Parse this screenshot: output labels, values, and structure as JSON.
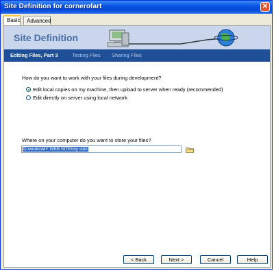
{
  "window": {
    "title": "Site Definition for cornerofart"
  },
  "tabs": {
    "basic": "Basic",
    "advanced": "Advanced"
  },
  "banner": {
    "title": "Site Definition"
  },
  "steps": {
    "current": "Editing Files, Part 3",
    "testing": "Testing Files",
    "sharing": "Sharing Files"
  },
  "question1": "How do you want to work with your files during development?",
  "options": {
    "local": {
      "label": "Edit local copies on my machine, then upload to server when ready (recommended)",
      "selected": true
    },
    "direct": {
      "label": "Edit directly on server using local network",
      "selected": false
    }
  },
  "question2": "Where on your computer do you want to store your files?",
  "path_value": "D:\\works\\MY WEB SITE\\my site\\",
  "buttons": {
    "back": "< Back",
    "next": "Next >",
    "cancel": "Cancel",
    "help": "Help"
  }
}
